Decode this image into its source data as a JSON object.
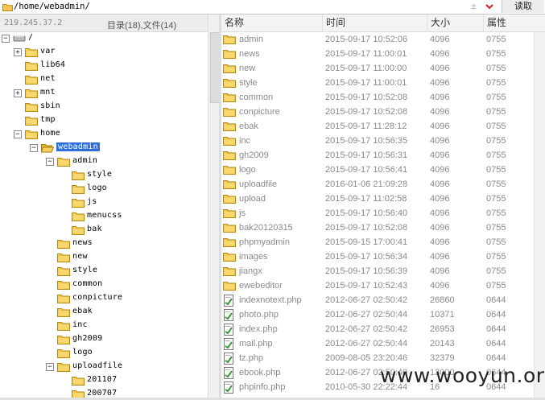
{
  "path_bar": {
    "path": "/home/webadmin/",
    "read_label": "读取",
    "pm_symbol": "±"
  },
  "left_pane": {
    "ip": "219.245.37.2",
    "count": "目录(18),文件(14)",
    "tree": [
      {
        "label": "/",
        "depth": 0,
        "expander": "minus",
        "icon": "drive-icon"
      },
      {
        "label": "var",
        "depth": 1,
        "expander": "plus",
        "icon": "folder-icon"
      },
      {
        "label": "lib64",
        "depth": 1,
        "expander": "",
        "icon": "folder-icon"
      },
      {
        "label": "net",
        "depth": 1,
        "expander": "",
        "icon": "folder-icon"
      },
      {
        "label": "mnt",
        "depth": 1,
        "expander": "plus",
        "icon": "folder-icon"
      },
      {
        "label": "sbin",
        "depth": 1,
        "expander": "",
        "icon": "folder-icon"
      },
      {
        "label": "tmp",
        "depth": 1,
        "expander": "",
        "icon": "folder-icon"
      },
      {
        "label": "home",
        "depth": 1,
        "expander": "minus",
        "icon": "folder-icon"
      },
      {
        "label": "webadmin",
        "depth": 2,
        "expander": "minus",
        "icon": "folder-open-icon",
        "selected": true
      },
      {
        "label": "admin",
        "depth": 3,
        "expander": "minus",
        "icon": "folder-icon"
      },
      {
        "label": "style",
        "depth": 4,
        "expander": "",
        "icon": "folder-icon"
      },
      {
        "label": "logo",
        "depth": 4,
        "expander": "",
        "icon": "folder-icon"
      },
      {
        "label": "js",
        "depth": 4,
        "expander": "",
        "icon": "folder-icon"
      },
      {
        "label": "menucss",
        "depth": 4,
        "expander": "",
        "icon": "folder-icon"
      },
      {
        "label": "bak",
        "depth": 4,
        "expander": "",
        "icon": "folder-icon"
      },
      {
        "label": "news",
        "depth": 3,
        "expander": "",
        "icon": "folder-icon"
      },
      {
        "label": "new",
        "depth": 3,
        "expander": "",
        "icon": "folder-icon"
      },
      {
        "label": "style",
        "depth": 3,
        "expander": "",
        "icon": "folder-icon"
      },
      {
        "label": "common",
        "depth": 3,
        "expander": "",
        "icon": "folder-icon"
      },
      {
        "label": "conpicture",
        "depth": 3,
        "expander": "",
        "icon": "folder-icon"
      },
      {
        "label": "ebak",
        "depth": 3,
        "expander": "",
        "icon": "folder-icon"
      },
      {
        "label": "inc",
        "depth": 3,
        "expander": "",
        "icon": "folder-icon"
      },
      {
        "label": "gh2009",
        "depth": 3,
        "expander": "",
        "icon": "folder-icon"
      },
      {
        "label": "logo",
        "depth": 3,
        "expander": "",
        "icon": "folder-icon"
      },
      {
        "label": "uploadfile",
        "depth": 3,
        "expander": "minus",
        "icon": "folder-icon"
      },
      {
        "label": "201107",
        "depth": 4,
        "expander": "",
        "icon": "folder-icon"
      },
      {
        "label": "200707",
        "depth": 4,
        "expander": "",
        "icon": "folder-icon"
      }
    ]
  },
  "right_pane": {
    "columns": [
      "名称",
      "时间",
      "大小",
      "属性"
    ],
    "rows": [
      {
        "name": "admin",
        "time": "2015-09-17 10:52:06",
        "size": "4096",
        "perm": "0755",
        "type": "folder"
      },
      {
        "name": "news",
        "time": "2015-09-17 11:00:01",
        "size": "4096",
        "perm": "0755",
        "type": "folder"
      },
      {
        "name": "new",
        "time": "2015-09-17 11:00:00",
        "size": "4096",
        "perm": "0755",
        "type": "folder"
      },
      {
        "name": "style",
        "time": "2015-09-17 11:00:01",
        "size": "4096",
        "perm": "0755",
        "type": "folder"
      },
      {
        "name": "common",
        "time": "2015-09-17 10:52:08",
        "size": "4096",
        "perm": "0755",
        "type": "folder"
      },
      {
        "name": "conpicture",
        "time": "2015-09-17 10:52:08",
        "size": "4096",
        "perm": "0755",
        "type": "folder"
      },
      {
        "name": "ebak",
        "time": "2015-09-17 11:28:12",
        "size": "4096",
        "perm": "0755",
        "type": "folder"
      },
      {
        "name": "inc",
        "time": "2015-09-17 10:56:35",
        "size": "4096",
        "perm": "0755",
        "type": "folder"
      },
      {
        "name": "gh2009",
        "time": "2015-09-17 10:56:31",
        "size": "4096",
        "perm": "0755",
        "type": "folder"
      },
      {
        "name": "logo",
        "time": "2015-09-17 10:56:41",
        "size": "4096",
        "perm": "0755",
        "type": "folder"
      },
      {
        "name": "uploadfile",
        "time": "2016-01-06 21:09:28",
        "size": "4096",
        "perm": "0755",
        "type": "folder"
      },
      {
        "name": "upload",
        "time": "2015-09-17 11:02:58",
        "size": "4096",
        "perm": "0755",
        "type": "folder"
      },
      {
        "name": "js",
        "time": "2015-09-17 10:56:40",
        "size": "4096",
        "perm": "0755",
        "type": "folder"
      },
      {
        "name": "bak20120315",
        "time": "2015-09-17 10:52:08",
        "size": "4096",
        "perm": "0755",
        "type": "folder"
      },
      {
        "name": "phpmyadmin",
        "time": "2015-09-15 17:00:41",
        "size": "4096",
        "perm": "0755",
        "type": "folder"
      },
      {
        "name": "images",
        "time": "2015-09-17 10:56:34",
        "size": "4096",
        "perm": "0755",
        "type": "folder"
      },
      {
        "name": "jiangx",
        "time": "2015-09-17 10:56:39",
        "size": "4096",
        "perm": "0755",
        "type": "folder"
      },
      {
        "name": "ewebeditor",
        "time": "2015-09-17 10:52:43",
        "size": "4096",
        "perm": "0755",
        "type": "folder"
      },
      {
        "name": "indexnotext.php",
        "time": "2012-06-27 02:50:42",
        "size": "26860",
        "perm": "0644",
        "type": "file"
      },
      {
        "name": "photo.php",
        "time": "2012-06-27 02:50:44",
        "size": "10371",
        "perm": "0644",
        "type": "file"
      },
      {
        "name": "index.php",
        "time": "2012-06-27 02:50:42",
        "size": "26953",
        "perm": "0644",
        "type": "file"
      },
      {
        "name": "mail.php",
        "time": "2012-06-27 02:50:44",
        "size": "20143",
        "perm": "0644",
        "type": "file"
      },
      {
        "name": "tz.php",
        "time": "2009-08-05 23:20:46",
        "size": "32379",
        "perm": "0644",
        "type": "file"
      },
      {
        "name": "ebook.php",
        "time": "2012-06-27 02:50:40",
        "size": "13000",
        "perm": "0644",
        "type": "file"
      },
      {
        "name": "phpinfo.php",
        "time": "2010-05-30 22:22:44",
        "size": "16",
        "perm": "0644",
        "type": "file"
      }
    ]
  },
  "watermark": "www.wooyun.org",
  "colors": {
    "folder": "#f4c84a",
    "selection": "#2f6fdc",
    "row_text": "#8a8a8a"
  }
}
